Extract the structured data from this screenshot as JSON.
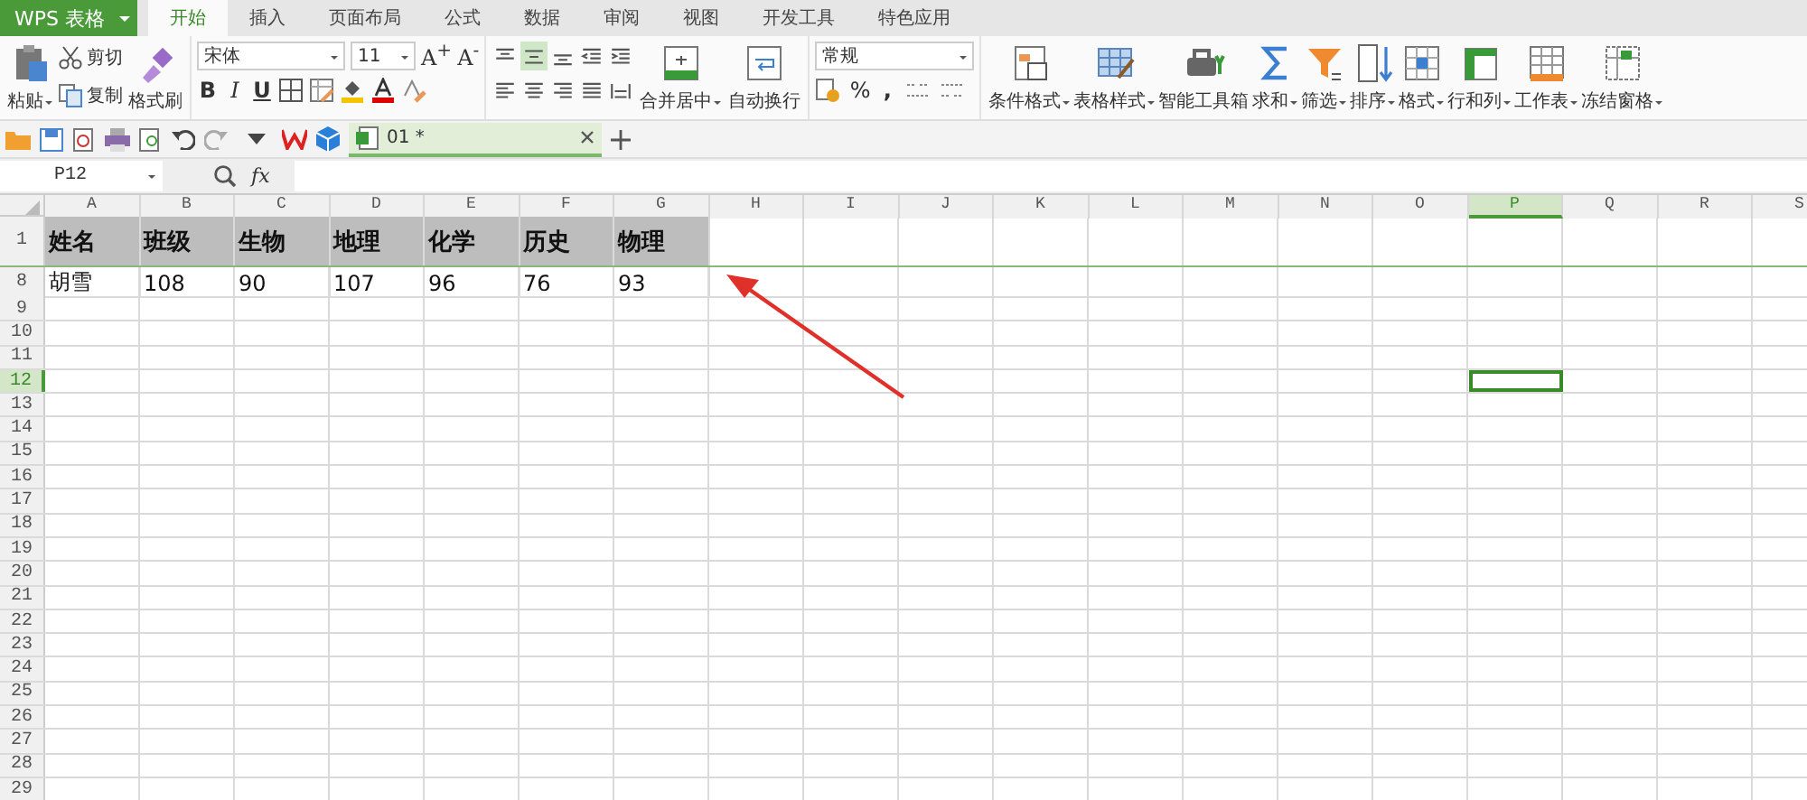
{
  "app_menu": {
    "label": "WPS 表格"
  },
  "tabs": [
    {
      "label": "开始",
      "selected": true
    },
    {
      "label": "插入",
      "selected": false
    },
    {
      "label": "页面布局",
      "selected": false
    },
    {
      "label": "公式",
      "selected": false
    },
    {
      "label": "数据",
      "selected": false
    },
    {
      "label": "审阅",
      "selected": false
    },
    {
      "label": "视图",
      "selected": false
    },
    {
      "label": "开发工具",
      "selected": false
    },
    {
      "label": "特色应用",
      "selected": false
    }
  ],
  "ribbon": {
    "paste": "粘贴",
    "cut": "剪切",
    "copy": "复制",
    "format_painter": "格式刷",
    "font_family": "宋体",
    "font_size": "11",
    "grow_font": "A$^{+}$",
    "shrink_font": "A$^{-}$",
    "bold": "B",
    "italic": "I",
    "underline": "U",
    "align_buttons": [
      {
        "kind": "top",
        "selected": false
      },
      {
        "kind": "middle",
        "selected": true
      },
      {
        "kind": "bottom",
        "selected": false
      },
      {
        "kind": "outdent",
        "selected": false
      },
      {
        "kind": "indent",
        "selected": false
      },
      {
        "kind": "left",
        "selected": false
      },
      {
        "kind": "center",
        "selected": false
      },
      {
        "kind": "right",
        "selected": false
      },
      {
        "kind": "justify",
        "selected": false
      },
      {
        "kind": "distributed",
        "selected": false
      }
    ],
    "merge_center": "合并居中",
    "wrap_text": "自动换行",
    "number_format": "常规",
    "percent": "%",
    "comma": ",",
    "large_buttons": [
      {
        "kind": "conditional",
        "label": "条件格式"
      },
      {
        "kind": "table-style",
        "label": "表格样式"
      },
      {
        "kind": "toolbox",
        "label": "智能工具箱"
      },
      {
        "kind": "sum",
        "label": "求和"
      },
      {
        "kind": "filter",
        "label": "筛选"
      },
      {
        "kind": "sort",
        "label": "排序"
      },
      {
        "kind": "format",
        "label": "格式"
      },
      {
        "kind": "rowcol",
        "label": "行和列"
      },
      {
        "kind": "sheet",
        "label": "工作表"
      },
      {
        "kind": "freeze",
        "label": "冻结窗格"
      }
    ]
  },
  "document_tab": {
    "title": "01 *"
  },
  "name_box": "P12",
  "fx": "fx",
  "columns": [
    {
      "label": "A",
      "selected": false
    },
    {
      "label": "B",
      "selected": false
    },
    {
      "label": "C",
      "selected": false
    },
    {
      "label": "D",
      "selected": false
    },
    {
      "label": "E",
      "selected": false
    },
    {
      "label": "F",
      "selected": false
    },
    {
      "label": "G",
      "selected": false
    },
    {
      "label": "H",
      "selected": false
    },
    {
      "label": "I",
      "selected": false
    },
    {
      "label": "J",
      "selected": false
    },
    {
      "label": "K",
      "selected": false
    },
    {
      "label": "L",
      "selected": false
    },
    {
      "label": "M",
      "selected": false
    },
    {
      "label": "N",
      "selected": false
    },
    {
      "label": "O",
      "selected": false
    },
    {
      "label": "P",
      "selected": true
    },
    {
      "label": "Q",
      "selected": false
    },
    {
      "label": "R",
      "selected": false
    },
    {
      "label": "S",
      "selected": false
    }
  ],
  "rows": [
    {
      "number": "1",
      "kind": "header",
      "selected": false,
      "cells": [
        "姓名",
        "班级",
        "生物",
        "地理",
        "化学",
        "历史",
        "物理"
      ]
    },
    {
      "number": "8",
      "kind": "data",
      "selected": false,
      "cells": [
        "胡雪",
        "108",
        "90",
        "107",
        "96",
        "76",
        "93"
      ]
    },
    {
      "number": "9",
      "kind": "data",
      "selected": false
    },
    {
      "number": "10",
      "kind": "data",
      "selected": false
    },
    {
      "number": "11",
      "kind": "data",
      "selected": false
    },
    {
      "number": "12",
      "kind": "data",
      "selected": true
    },
    {
      "number": "13",
      "kind": "data",
      "selected": false
    },
    {
      "number": "14",
      "kind": "data",
      "selected": false
    },
    {
      "number": "15",
      "kind": "data",
      "selected": false
    },
    {
      "number": "16",
      "kind": "data",
      "selected": false
    },
    {
      "number": "17",
      "kind": "data",
      "selected": false
    },
    {
      "number": "18",
      "kind": "data",
      "selected": false
    },
    {
      "number": "19",
      "kind": "data",
      "selected": false
    },
    {
      "number": "20",
      "kind": "data",
      "selected": false
    },
    {
      "number": "21",
      "kind": "data",
      "selected": false
    },
    {
      "number": "22",
      "kind": "data",
      "selected": false
    },
    {
      "number": "23",
      "kind": "data",
      "selected": false
    },
    {
      "number": "24",
      "kind": "data",
      "selected": false
    },
    {
      "number": "25",
      "kind": "data",
      "selected": false
    },
    {
      "number": "26",
      "kind": "data",
      "selected": false
    },
    {
      "number": "27",
      "kind": "data",
      "selected": false
    },
    {
      "number": "28",
      "kind": "data",
      "selected": false
    },
    {
      "number": "29",
      "kind": "data",
      "selected": false
    }
  ],
  "annotation": {
    "kind": "arrow"
  }
}
